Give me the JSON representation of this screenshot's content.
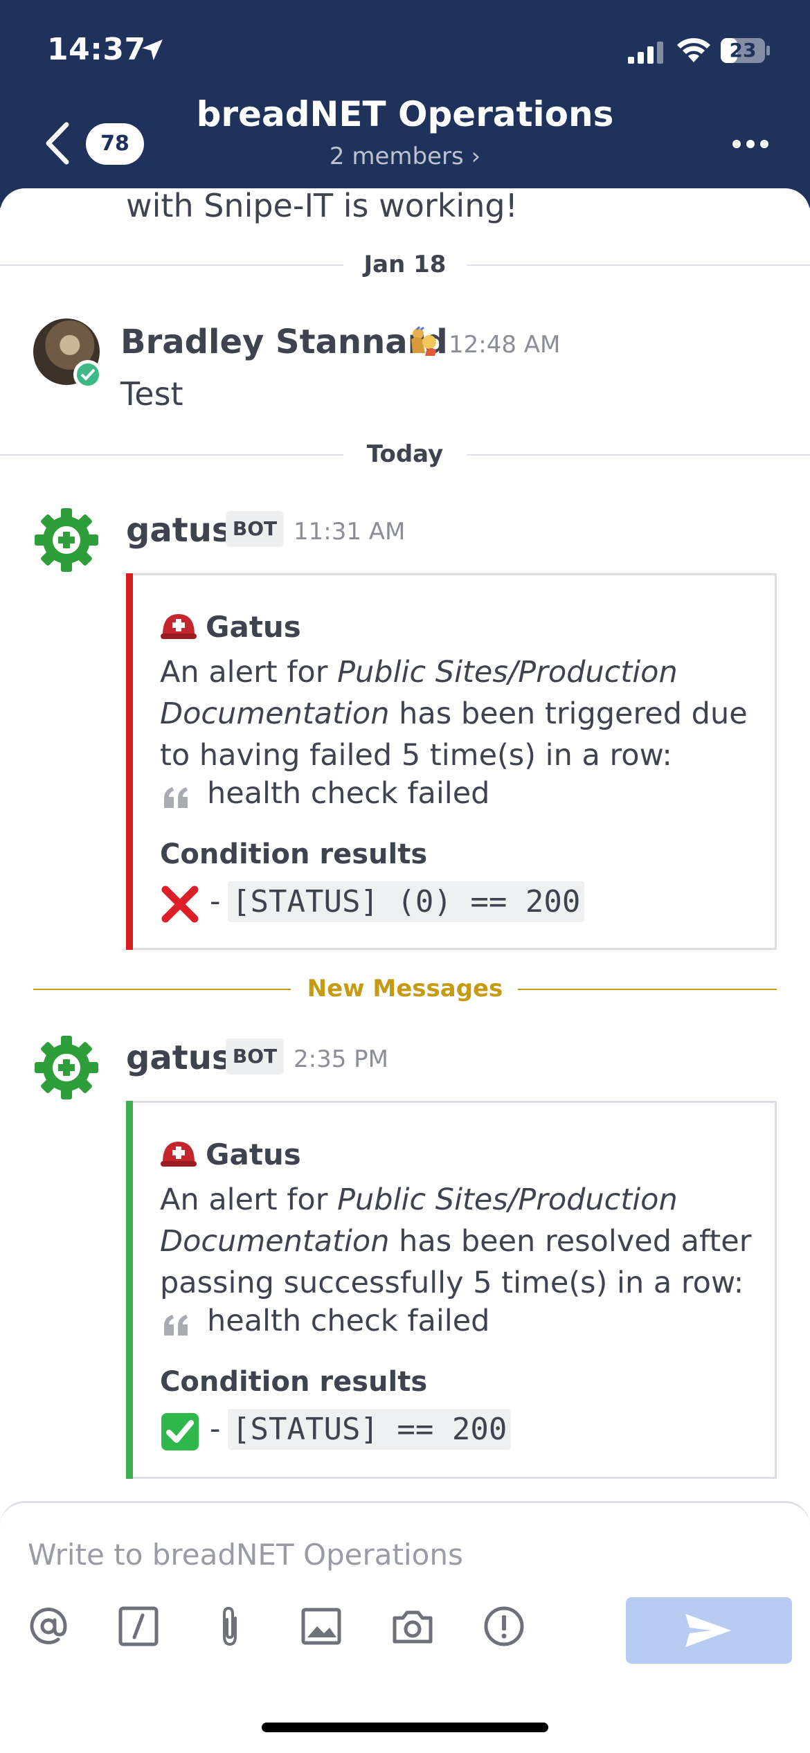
{
  "status_bar": {
    "time": "14:37",
    "battery": "23"
  },
  "header": {
    "back_badge": "78",
    "title": "breadNET Operations",
    "subtitle": "2 members ›"
  },
  "messages": {
    "cut_off_text": "with Snipe-IT is working!",
    "divider_jan": "Jan 18",
    "post1": {
      "author": "Bradley Stannard",
      "time": "12:48 AM",
      "text": "Test"
    },
    "divider_today": "Today",
    "post2": {
      "author": "gatus",
      "bot_label": "BOT",
      "time": "11:31 AM",
      "attachment": {
        "bar_color": "#d81e1e",
        "title": "Gatus",
        "line1_pre": "An alert for ",
        "line1_em": "Public Sites/Production",
        "line2_em": "Documentation",
        "line2_post": " has been triggered due",
        "line3": "to having failed 5 time(s) in a row:",
        "quote": "health check failed",
        "conditions_title": "Condition results",
        "condition_dash": "-",
        "condition_code": "[STATUS] (0) == 200"
      }
    },
    "new_messages_label": "New Messages",
    "post3": {
      "author": "gatus",
      "bot_label": "BOT",
      "time": "2:35 PM",
      "attachment": {
        "bar_color": "#3db052",
        "title": "Gatus",
        "line1_pre": "An alert for ",
        "line1_em": "Public Sites/Production",
        "line2_em": "Documentation",
        "line2_post": " has been resolved after",
        "line3": "passing successfully 5 time(s) in a row:",
        "quote": "health check failed",
        "conditions_title": "Condition results",
        "condition_dash": "-",
        "condition_code": "[STATUS] == 200"
      }
    }
  },
  "composer": {
    "placeholder": "Write to breadNET Operations",
    "tools": [
      "at-mention-icon",
      "slash-command-icon",
      "paperclip-icon",
      "image-icon",
      "camera-icon",
      "priority-icon"
    ]
  },
  "colors": {
    "header_bg": "#1e325c",
    "new_messages": "#c69a12",
    "send_button": "#b8ccf2"
  }
}
